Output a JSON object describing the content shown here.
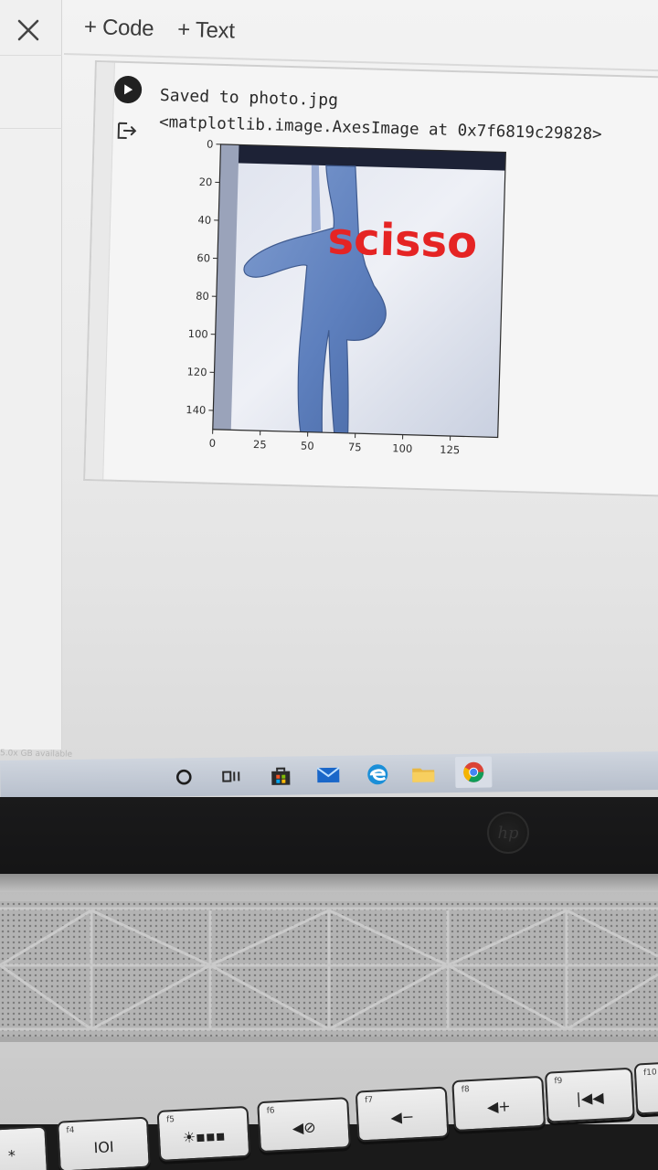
{
  "toolbar": {
    "close_icon": "close-icon",
    "add_code_label": "+ Code",
    "add_text_label": "+ Text"
  },
  "cell": {
    "run_icon": "play-icon",
    "output_icon": "output-arrow-icon",
    "output_lines": [
      "Saved to photo.jpg",
      "<matplotlib.image.AxesImage at 0x7f6819c29828>"
    ],
    "plot": {
      "image_caption_text": "scisso",
      "y_ticks": [
        "0",
        "20",
        "40",
        "60",
        "80",
        "100",
        "120",
        "140"
      ],
      "x_ticks": [
        "0",
        "25",
        "50",
        "75",
        "100",
        "125"
      ],
      "label_color": "#e52424"
    }
  },
  "status": {
    "disk_note": "5.0x GB available"
  },
  "taskbar": {
    "icons": [
      "cortana-icon",
      "task-view-icon",
      "store-icon",
      "mail-icon",
      "edge-icon",
      "file-explorer-icon",
      "chrome-icon"
    ]
  },
  "keyboard": {
    "fkeys": [
      {
        "label": "",
        "icon": "*"
      },
      {
        "label": "f4",
        "icon": "IOI"
      },
      {
        "label": "f5",
        "icon": "☀▪▪▪"
      },
      {
        "label": "f6",
        "icon": "◀⊘"
      },
      {
        "label": "f7",
        "icon": "◀−"
      },
      {
        "label": "f8",
        "icon": "◀+"
      },
      {
        "label": "f9",
        "icon": "|◀◀"
      },
      {
        "label": "f10",
        "icon": ""
      }
    ]
  }
}
